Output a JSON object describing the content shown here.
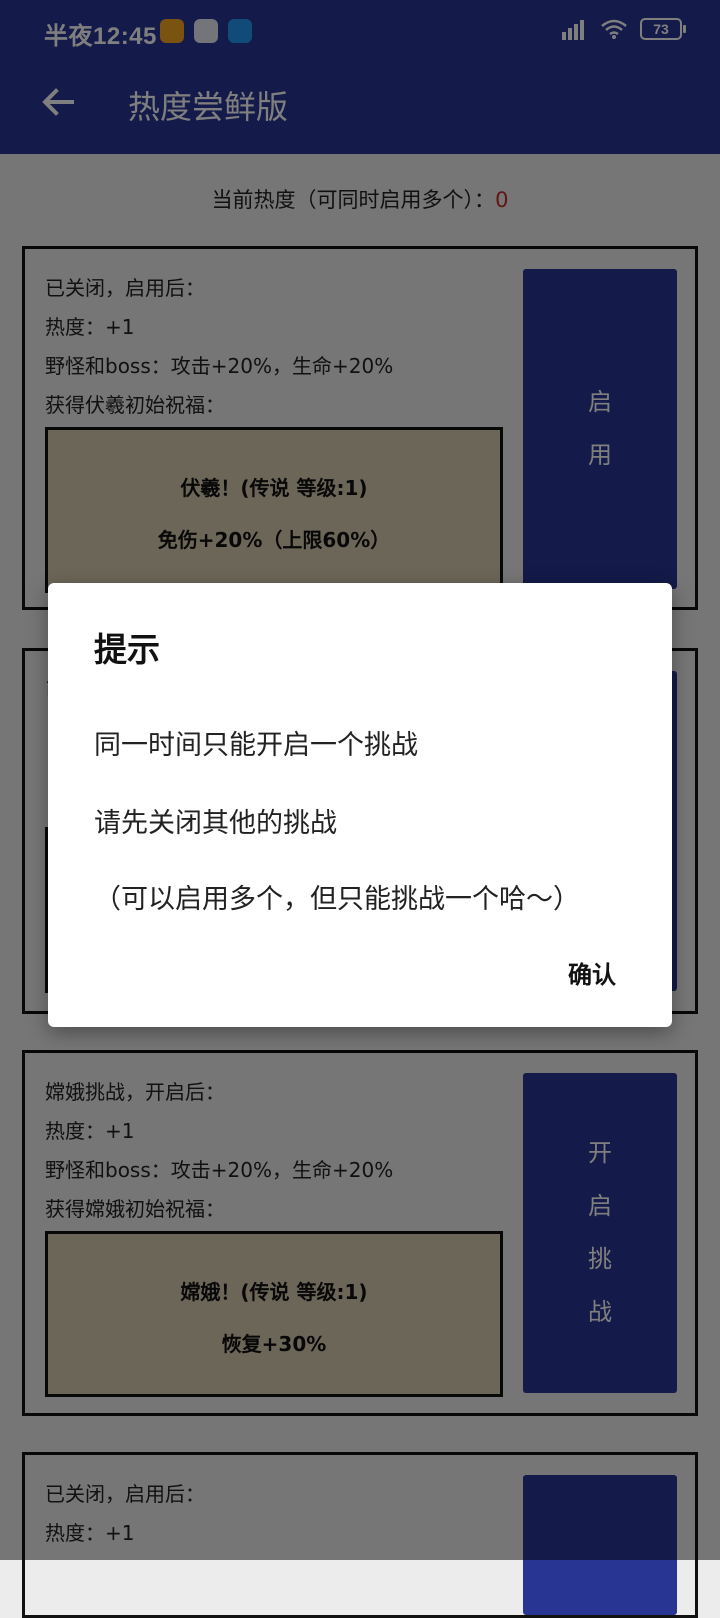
{
  "status": {
    "time": "半夜12:45",
    "battery": "73"
  },
  "toolbar": {
    "title": "热度尝鲜版"
  },
  "header": {
    "label": "当前热度（可同时启用多个）：",
    "value": "0"
  },
  "cards": [
    {
      "lines": [
        "已关闭，启用后：",
        "热度：+1",
        "野怪和boss：攻击+20%，生命+20%",
        "获得伏羲初始祝福："
      ],
      "blessing": {
        "name": "伏羲！(传说 等级:1)",
        "effect": "免伤+20%（上限60%）"
      },
      "button": [
        "启",
        "用"
      ]
    },
    {
      "lines": [
        "嫦娥挑战，开启后：",
        "热度：+1",
        "野怪和boss：攻击+20%，生命+20%",
        "获得嫦娥初始祝福："
      ],
      "blessing": {
        "name": "嫦娥！(传说 等级:1)",
        "effect": "恢复+30%"
      },
      "button": [
        "开",
        "启",
        "挑",
        "战"
      ]
    },
    {
      "lines": [
        "已关闭，启用后：",
        "热度：+1"
      ]
    }
  ],
  "dialog": {
    "title": "提示",
    "messages": [
      "同一时间只能开启一个挑战",
      "请先关闭其他的挑战",
      "（可以启用多个，但只能挑战一个哈～）"
    ],
    "confirm": "确认"
  },
  "colors": {
    "primary": "#283593",
    "card_inner": "#d9ccb0",
    "heat_value": "#c62828"
  }
}
